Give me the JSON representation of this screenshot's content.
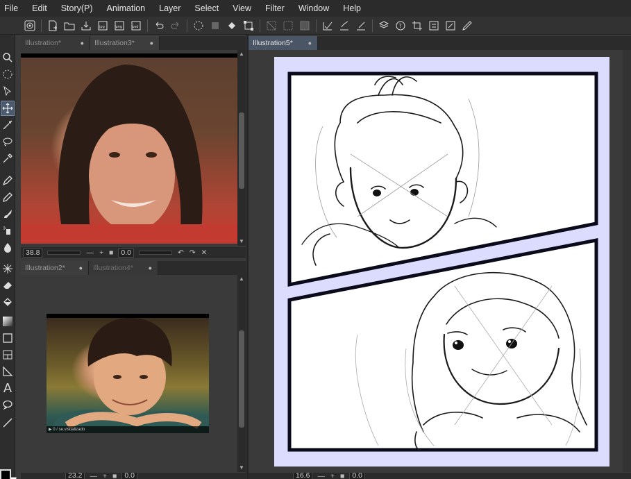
{
  "menu": [
    "File",
    "Edit",
    "Story(P)",
    "Animation",
    "Layer",
    "Select",
    "View",
    "Filter",
    "Window",
    "Help"
  ],
  "command_icons": [
    "spiral-icon",
    "new-icon",
    "open-icon",
    "save-icon",
    "export-jpg-icon",
    "export-png-icon",
    "export-psd-icon",
    "undo-icon",
    "redo-icon",
    "loading-icon",
    "clear-icon",
    "fill-icon",
    "transform-icon",
    "deselect-icon",
    "invert-selection-icon",
    "select-all-icon",
    "check-icon",
    "brush-check-icon",
    "pen-check-icon",
    "material-icon",
    "help-icon",
    "crop-icon",
    "settings-icon",
    "export-icon",
    "edit-icon"
  ],
  "tools": [
    "zoom-icon",
    "lasso-icon",
    "object-icon",
    "move-icon",
    "magic-wand-icon",
    "lasso-select-icon",
    "eyedropper-icon",
    "pen-icon",
    "pencil-icon",
    "brush-icon",
    "airbrush-icon",
    "blend-icon",
    "decoration-icon",
    "eraser-icon",
    "fill-icon",
    "gradient-icon",
    "figure-icon",
    "frame-icon",
    "ruler-icon",
    "text-icon",
    "balloon-icon",
    "line-icon"
  ],
  "panel_top": {
    "tabs": [
      {
        "label": "Illustration*",
        "dot": "●"
      },
      {
        "label": "Illustration3*",
        "dot": "●"
      }
    ],
    "status": {
      "zoom": "38.8",
      "rotation": "0.0"
    }
  },
  "panel_bottom": {
    "tabs": [
      {
        "label": "Illustration2*",
        "dot": "●"
      },
      {
        "label": "Illustration4*",
        "dot": "●"
      }
    ],
    "status": {
      "zoom": "23.2",
      "rotation": "0.0"
    },
    "video_caption": "▶ 0 / se.visualizado"
  },
  "panel_right": {
    "tabs": [
      {
        "label": "Illustration5*",
        "dot": "●"
      }
    ],
    "status": {
      "zoom": "16.6",
      "rotation": "0.0"
    }
  },
  "colors": {
    "main": "#000000",
    "sub": "#ffffff",
    "page_bg": "#dcdcff",
    "tab_active": "#4a5566"
  }
}
